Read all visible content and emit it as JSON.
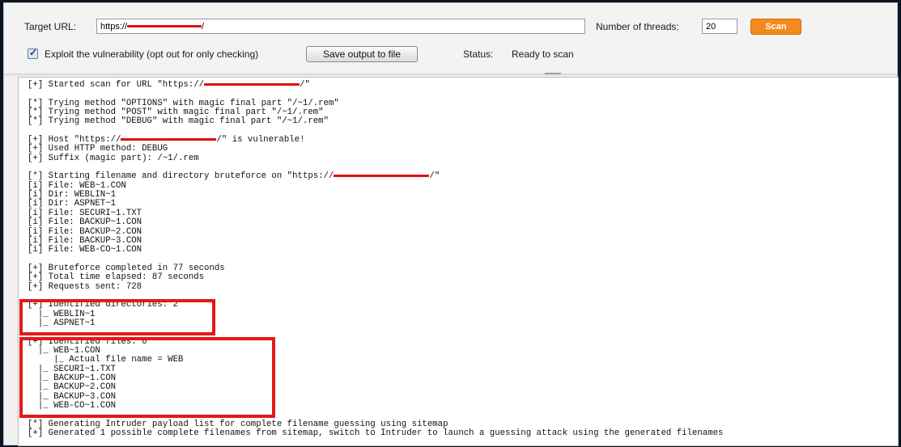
{
  "toolbar": {
    "target_url_label": "Target URL:",
    "target_url_prefix": "https://",
    "target_url_suffix": "/",
    "threads_label": "Number of threads:",
    "threads_value": "20",
    "scan_label": "Scan",
    "exploit_checked": true,
    "exploit_label": "Exploit the vulnerability (opt out for only checking)",
    "save_label": "Save output to file",
    "status_label": "Status:",
    "status_value": "Ready to scan"
  },
  "output": {
    "lines": [
      {
        "pre": "[+] Started scan for URL \"https://",
        "redact": true,
        "post": "/\""
      },
      {
        "pre": ""
      },
      {
        "pre": "[*] Trying method \"OPTIONS\" with magic final part \"/~1/.rem\""
      },
      {
        "pre": "[*] Trying method \"POST\" with magic final part \"/~1/.rem\""
      },
      {
        "pre": "[*] Trying method \"DEBUG\" with magic final part \"/~1/.rem\""
      },
      {
        "pre": ""
      },
      {
        "pre": "[+] Host \"https://",
        "redact": true,
        "post": "/\" is vulnerable!"
      },
      {
        "pre": "[+] Used HTTP method: DEBUG"
      },
      {
        "pre": "[+] Suffix (magic part): /~1/.rem"
      },
      {
        "pre": ""
      },
      {
        "pre": "[*] Starting filename and directory bruteforce on \"https://",
        "redact": true,
        "post": "/\""
      },
      {
        "pre": "[i] File: WEB~1.CON"
      },
      {
        "pre": "[i] Dir: WEBLIN~1"
      },
      {
        "pre": "[i] Dir: ASPNET~1"
      },
      {
        "pre": "[i] File: SECURI~1.TXT"
      },
      {
        "pre": "[i] File: BACKUP~1.CON"
      },
      {
        "pre": "[i] File: BACKUP~2.CON"
      },
      {
        "pre": "[i] File: BACKUP~3.CON"
      },
      {
        "pre": "[i] File: WEB-CO~1.CON"
      },
      {
        "pre": ""
      },
      {
        "pre": "[+] Bruteforce completed in 77 seconds"
      },
      {
        "pre": "[+] Total time elapsed: 87 seconds"
      },
      {
        "pre": "[+] Requests sent: 728"
      },
      {
        "pre": ""
      },
      {
        "pre": "[+] Identified directories: 2"
      },
      {
        "pre": "  |_ WEBLIN~1"
      },
      {
        "pre": "  |_ ASPNET~1"
      },
      {
        "pre": ""
      },
      {
        "pre": "[+] Identified files: 6"
      },
      {
        "pre": "  |_ WEB~1.CON"
      },
      {
        "pre": "     |_ Actual file name = WEB"
      },
      {
        "pre": "  |_ SECURI~1.TXT"
      },
      {
        "pre": "  |_ BACKUP~1.CON"
      },
      {
        "pre": "  |_ BACKUP~2.CON"
      },
      {
        "pre": "  |_ BACKUP~3.CON"
      },
      {
        "pre": "  |_ WEB-CO~1.CON"
      },
      {
        "pre": ""
      },
      {
        "pre": "[*] Generating Intruder payload list for complete filename guessing using sitemap"
      },
      {
        "pre": "[+] Generated 1 possible complete filenames from sitemap, switch to Intruder to launch a guessing attack using the generated filenames"
      }
    ]
  },
  "colors": {
    "scan_button": "#f4891c",
    "highlight_box": "#e51818",
    "redaction": "#e01010"
  }
}
